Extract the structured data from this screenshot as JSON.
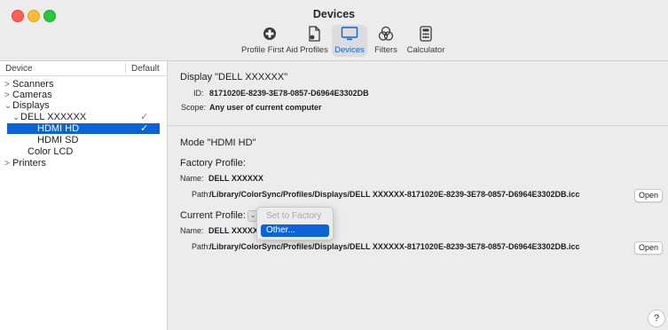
{
  "window": {
    "title": "Devices"
  },
  "toolbar": {
    "items": [
      {
        "label": "Profile First Aid",
        "icon": "first-aid-icon"
      },
      {
        "label": "Profiles",
        "icon": "profiles-icon"
      },
      {
        "label": "Devices",
        "icon": "display-icon",
        "selected": true
      },
      {
        "label": "Filters",
        "icon": "filters-icon"
      },
      {
        "label": "Calculator",
        "icon": "calculator-icon"
      }
    ]
  },
  "sidebar": {
    "header": {
      "device": "Device",
      "default": "Default"
    },
    "rows": [
      {
        "label": "Scanners",
        "arrow": ">",
        "check": ""
      },
      {
        "label": "Cameras",
        "arrow": ">",
        "check": ""
      },
      {
        "label": "Displays",
        "arrow": "⌄",
        "check": ""
      },
      {
        "label": "DELL XXXXXX",
        "arrow": "⌄",
        "check": "✓"
      },
      {
        "label": "HDMI HD",
        "arrow": "",
        "check": "✓",
        "selected": true
      },
      {
        "label": "HDMI SD",
        "arrow": "",
        "check": ""
      },
      {
        "label": "Color LCD",
        "arrow": "",
        "check": ""
      },
      {
        "label": "Printers",
        "arrow": ">",
        "check": ""
      }
    ]
  },
  "display_info": {
    "title": "Display \"DELL XXXXXX\"",
    "id_label": "ID:",
    "id_value": "8171020E-8239-3E78-0857-D6964E3302DB",
    "scope_label": "Scope:",
    "scope_value": "Any user of current computer"
  },
  "mode": {
    "title": "Mode \"HDMI HD\"",
    "factory_profile_label": "Factory Profile:",
    "factory_name_label": "Name:",
    "factory_name_value": "DELL XXXXXX",
    "factory_path_label": "Path:",
    "factory_path_value": "/Library/ColorSync/Profiles/Displays/DELL XXXXXX-8171020E-8239-3E78-0857-D6964E3302DB.icc",
    "factory_open_label": "Open",
    "current_profile_label": "Current Profile:",
    "current_name_label": "Name:",
    "current_name_value": "DELL XXXXX",
    "current_path_label": "Path:",
    "current_path_value": "/Library/ColorSync/Profiles/Displays/DELL XXXXXX-8171020E-8239-3E78-0857-D6964E3302DB.icc",
    "current_open_label": "Open"
  },
  "popup_menu": {
    "items": [
      {
        "label": "Set to Factory",
        "state": "disabled"
      },
      {
        "label": "Other...",
        "state": "highlighted"
      }
    ]
  },
  "help": {
    "label": "?"
  },
  "colors": {
    "accent": "#0a63d8",
    "toolbar_bg": "#ececec",
    "content_bg": "#ececec"
  }
}
